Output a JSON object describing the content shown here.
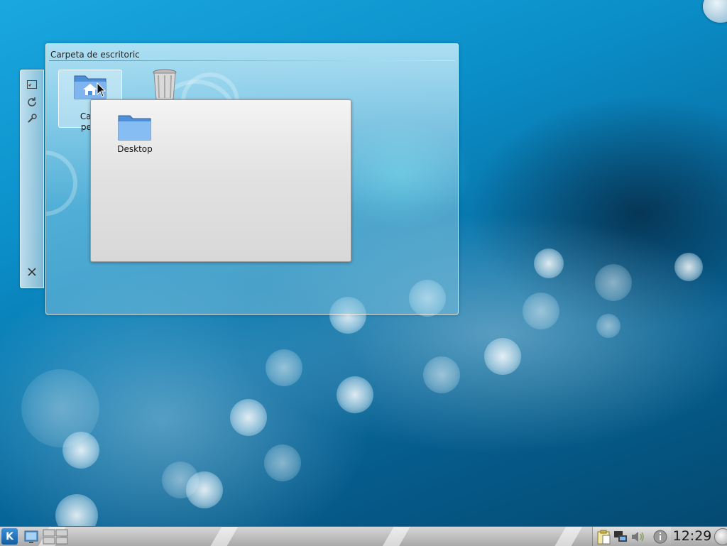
{
  "folder_view": {
    "title": "Carpeta de escritoric",
    "items": [
      {
        "label": "Carp",
        "label_line2": "pers",
        "icon": "home-folder-icon"
      },
      {
        "label": "",
        "icon": "trash-icon"
      }
    ]
  },
  "popup": {
    "items": [
      {
        "label": "Desktop",
        "icon": "folder-icon"
      }
    ]
  },
  "side_handle": {
    "buttons": [
      "resize-icon",
      "rotate-icon",
      "settings-wrench-icon",
      "close-icon"
    ]
  },
  "panel": {
    "kmenu_glyph": "K",
    "clock": "12:29",
    "tray_icons": [
      "clipboard-icon",
      "network-icon",
      "volume-icon",
      "info-icon"
    ]
  },
  "colors": {
    "accent": "#1a8fd0",
    "popup_bg": "#e0e0e0"
  }
}
